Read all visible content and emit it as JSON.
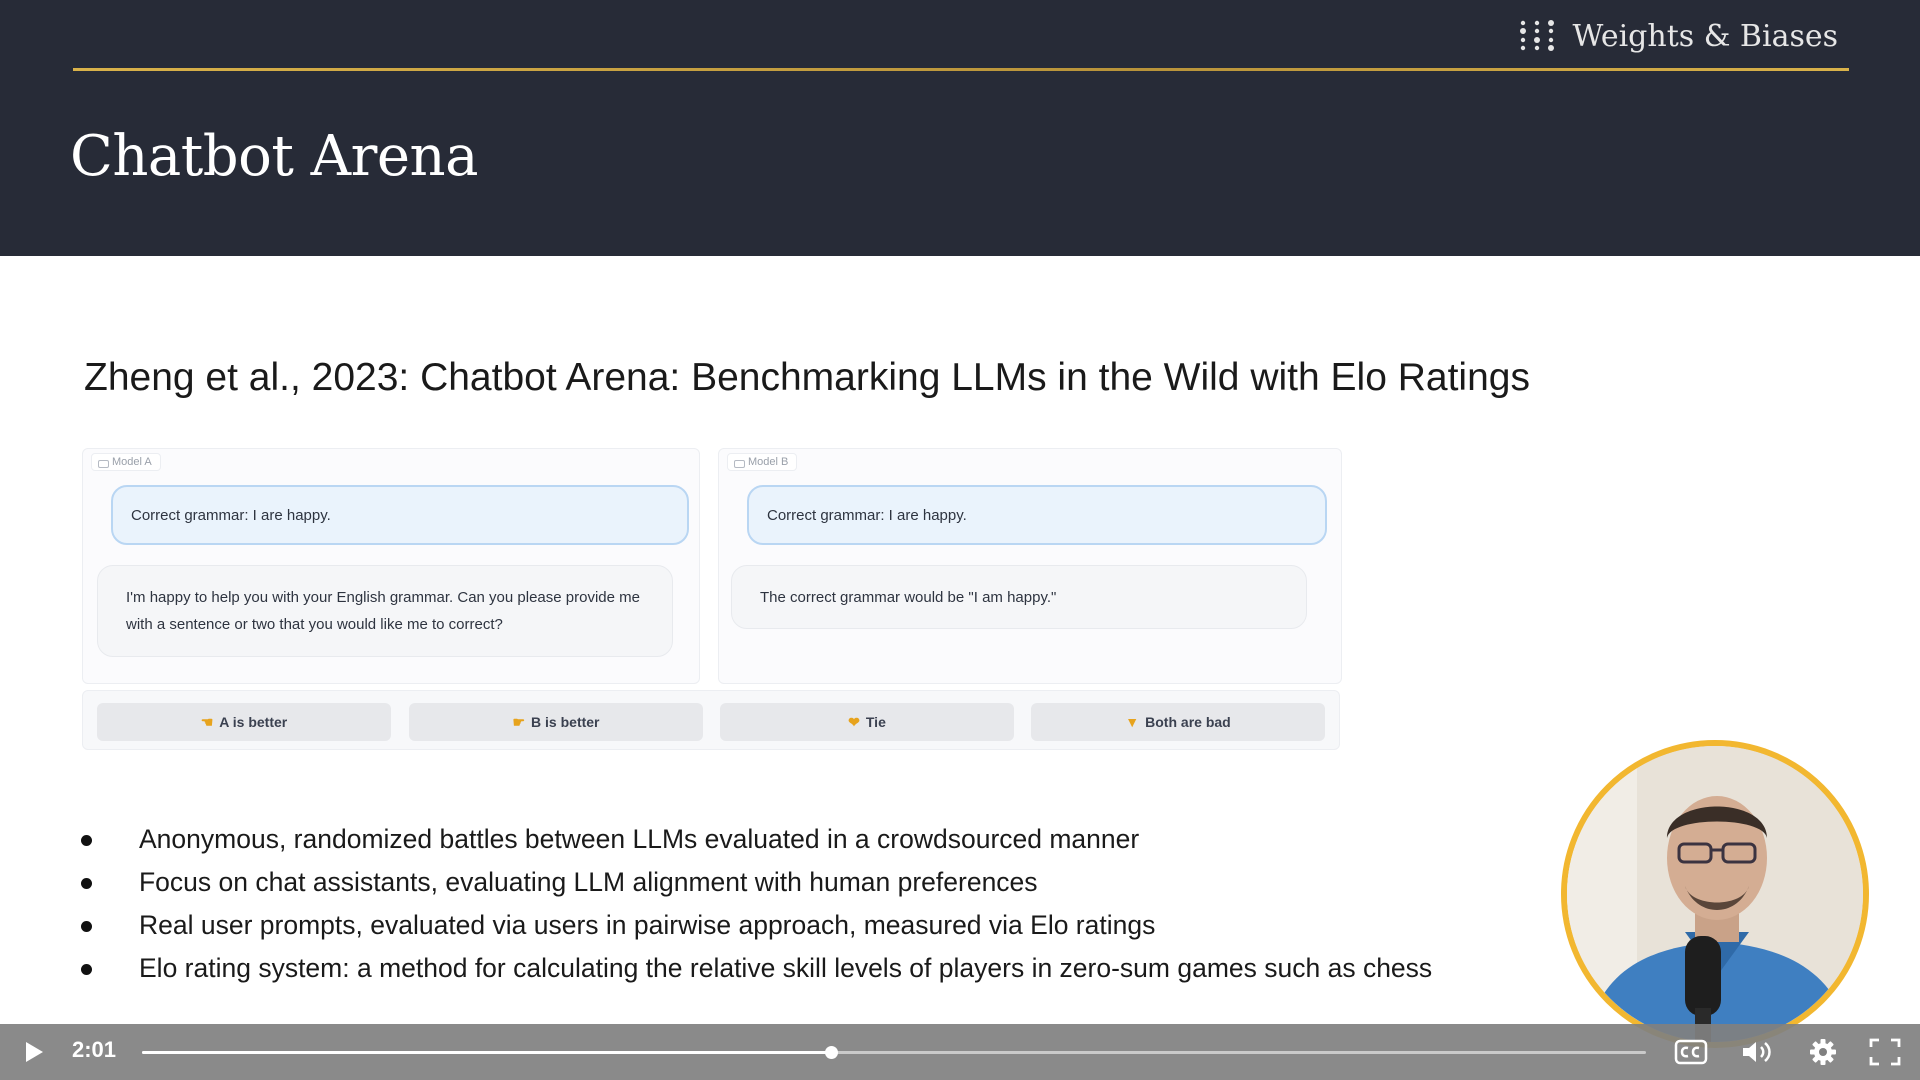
{
  "header": {
    "brand_name": "Weights & Biases",
    "title": "Chatbot Arena"
  },
  "slide": {
    "paper_title": "Zheng et al., 2023: Chatbot Arena: Benchmarking LLMs in the Wild with Elo Ratings",
    "figure": {
      "panel_a": {
        "tag": "Model A",
        "user_message": "Correct grammar: I are happy.",
        "bot_message": "I'm happy to help you with your English grammar. Can you please provide me with a sentence or two that you would like me to correct?"
      },
      "panel_b": {
        "tag": "Model B",
        "user_message": "Correct grammar: I are happy.",
        "bot_message": "The correct grammar would be \"I am happy.\""
      },
      "votes": [
        {
          "label": "A is better",
          "icon": "point-left-emoji"
        },
        {
          "label": "B is better",
          "icon": "point-right-emoji"
        },
        {
          "label": "Tie",
          "icon": "handshake-emoji"
        },
        {
          "label": "Both are bad",
          "icon": "thumbs-down-emoji"
        }
      ]
    },
    "bullets": [
      "Anonymous, randomized battles between LLMs evaluated in a crowdsourced manner",
      "Focus on chat assistants, evaluating LLM alignment with human preferences",
      "Real user prompts, evaluated via users in pairwise approach, measured via Elo ratings",
      "Elo rating system: a method for calculating the relative skill levels of players in zero-sum games such as chess"
    ]
  },
  "player": {
    "time": "2:01",
    "progress": 0.458,
    "accent_color": "#f2b730",
    "icons": [
      "play-icon",
      "closed-captions-icon",
      "volume-icon",
      "settings-gear-icon",
      "fullscreen-icon"
    ]
  }
}
